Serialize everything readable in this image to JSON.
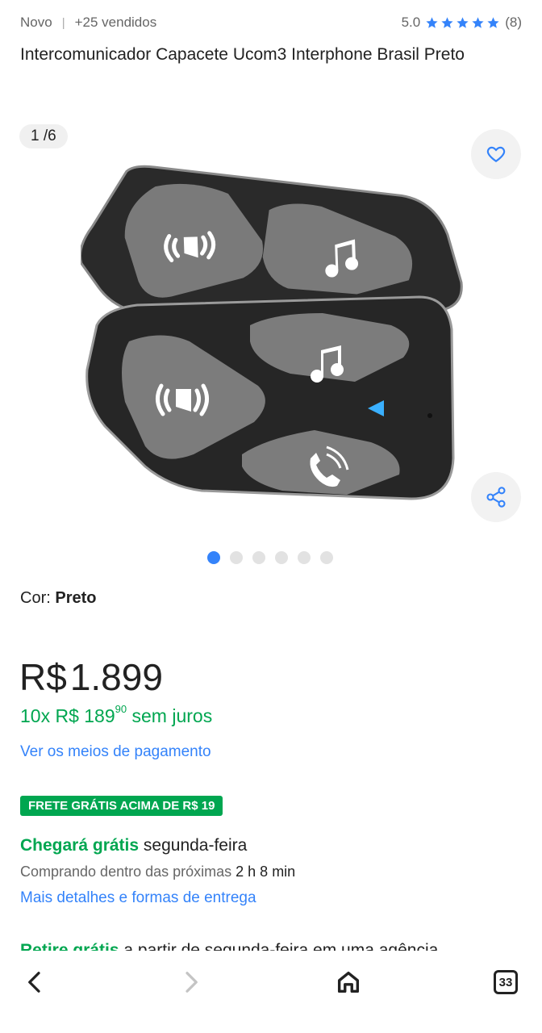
{
  "meta": {
    "condition": "Novo",
    "separator": "|",
    "sold": "+25 vendidos",
    "rating": "5.0",
    "review_count": "(8)",
    "stars": 5
  },
  "product": {
    "title": "Intercomunicador Capacete Ucom3 Interphone Brasil Preto"
  },
  "gallery": {
    "counter": "1 /6",
    "total_images": 6,
    "active_index": 0
  },
  "variant": {
    "label": "Cor:",
    "value": "Preto"
  },
  "price": {
    "currency": "R$",
    "amount": "1.899",
    "installments_prefix": "10x R$ 189",
    "installments_cents": "90",
    "installments_suffix": "sem juros",
    "payment_link": "Ver os meios de pagamento"
  },
  "shipping": {
    "badge": "FRETE GRÁTIS ACIMA DE R$ 19",
    "arrive_green": "Chegará grátis",
    "arrive_day": "segunda-feira",
    "buying_prefix": "Comprando dentro das próximas",
    "buying_time": "2 h 8 min",
    "details_link": "Mais detalhes e formas de entrega",
    "pickup_green": "Retire grátis",
    "pickup_rest": "a partir de segunda-feira em uma agência"
  },
  "browser": {
    "tab_count": "33"
  },
  "colors": {
    "accent": "#3483fa",
    "green": "#00a650"
  },
  "icons": [
    "star-icon",
    "heart-icon",
    "share-icon",
    "chevron-left-icon",
    "chevron-right-icon",
    "home-icon",
    "tabs-icon"
  ]
}
